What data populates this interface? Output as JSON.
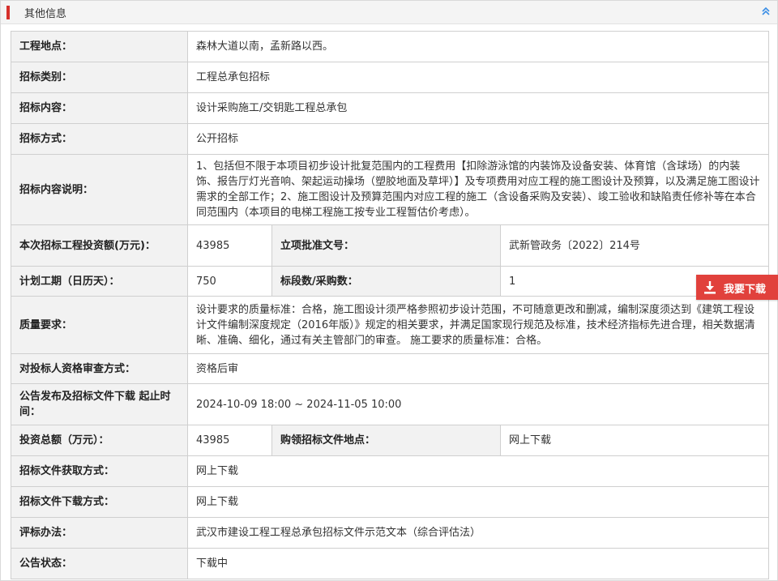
{
  "section": {
    "title": "其他信息"
  },
  "rows": {
    "location": {
      "label": "工程地点：",
      "value": "森林大道以南，孟新路以西。"
    },
    "category": {
      "label": "招标类别：",
      "value": "工程总承包招标"
    },
    "content": {
      "label": "招标内容：",
      "value": "设计采购施工/交钥匙工程总承包"
    },
    "method": {
      "label": "招标方式：",
      "value": "公开招标"
    },
    "description": {
      "label": "招标内容说明：",
      "value": "1、包括但不限于本项目初步设计批复范围内的工程费用【扣除游泳馆的内装饰及设备安装、体育馆（含球场）的内装饰、报告厅灯光音响、架起运动操场（塑胶地面及草坪）】及专项费用对应工程的施工图设计及预算，以及满足施工图设计需求的全部工作；2、施工图设计及预算范围内对应工程的施工（含设备采购及安装）、竣工验收和缺陷责任修补等在本合同范围内（本项目的电梯工程施工按专业工程暂估价考虑）。"
    },
    "investment": {
      "label": "本次招标工程投资额(万元)：",
      "value": "43985",
      "label2": "立项批准文号：",
      "value2": "武新管政务〔2022〕214号"
    },
    "period": {
      "label": "计划工期（日历天）：",
      "value": "750",
      "label2": "标段数/采购数：",
      "value2": "1"
    },
    "quality": {
      "label": "质量要求：",
      "value": "设计要求的质量标准：合格，施工图设计须严格参照初步设计范围，不可随意更改和删减，编制深度须达到《建筑工程设计文件编制深度规定（2016年版）》规定的相关要求，并满足国家现行规范及标准，技术经济指标先进合理，相关数据清晰、准确、细化，通过有关主管部门的审查。 施工要求的质量标准：合格。"
    },
    "qualification": {
      "label": "对投标人资格审查方式：",
      "value": "资格后审"
    },
    "publish_time": {
      "label": "公告发布及招标文件下载 起止时间：",
      "value": "2024-10-09 18:00 ~ 2024-11-05 10:00"
    },
    "total_investment": {
      "label": "投资总额（万元）：",
      "value": "43985",
      "label2": "购领招标文件地点：",
      "value2": "网上下载"
    },
    "doc_obtain": {
      "label": "招标文件获取方式：",
      "value": "网上下载"
    },
    "doc_download": {
      "label": "招标文件下载方式：",
      "value": "网上下载"
    },
    "evaluation": {
      "label": "评标办法：",
      "value": "武汉市建设工程工程总承包招标文件示范文本（综合评估法）"
    },
    "status": {
      "label": "公告状态：",
      "value": "下载中"
    }
  },
  "download_button": {
    "label": "我要下载"
  },
  "icons": {
    "collapse": "chevron-double-up-icon",
    "download": "download-icon"
  },
  "colors": {
    "accent": "#d6302b",
    "button": "#e1413c",
    "status": "#1c8a1c"
  }
}
